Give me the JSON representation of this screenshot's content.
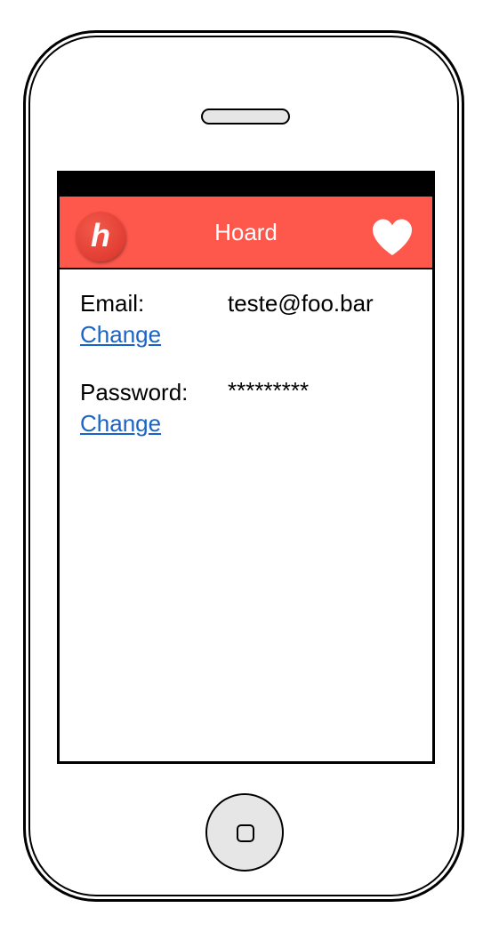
{
  "app": {
    "title": "Hoard",
    "logo_letter": "h",
    "accent_color": "#fe574b"
  },
  "icons": {
    "logo": "hoard-logo-icon",
    "favorite": "heart-icon",
    "home": "home-button-icon"
  },
  "account": {
    "email": {
      "label": "Email:",
      "value": "teste@foo.bar",
      "change_label": "Change"
    },
    "password": {
      "label": "Password:",
      "value": "*********",
      "change_label": "Change"
    }
  }
}
